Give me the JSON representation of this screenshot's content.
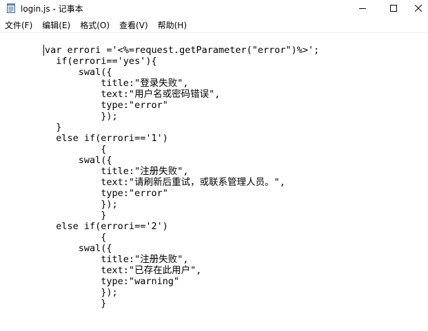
{
  "window": {
    "title": "login.js - 记事本",
    "icon": "notepad-icon",
    "controls": {
      "minimize_icon": "minimize-icon",
      "maximize_icon": "maximize-icon",
      "close_icon": "close-icon"
    }
  },
  "menu": [
    {
      "label": "文件(F)"
    },
    {
      "label": "编辑(E)"
    },
    {
      "label": "格式(O)"
    },
    {
      "label": "查看(V)"
    },
    {
      "label": "帮助(H)"
    }
  ],
  "editor": {
    "lines": [
      "        var errori ='<%=request.getParameter(\"error\")%>';",
      "          if(errori=='yes'){",
      "              swal({",
      "                  title:\"登录失败\",",
      "                  text:\"用户名或密码错误\",",
      "                  type:\"error\"",
      "                  });",
      "          }",
      "          else if(errori=='1')",
      "                  {",
      "              swal({",
      "                  title:\"注册失败\",",
      "                  text:\"请刷新后重试，或联系管理人员。\",",
      "                  type:\"error\"",
      "                  });",
      "                  }",
      "          else if(errori=='2')",
      "                  {",
      "              swal({",
      "                  title:\"注册失败\",",
      "                  text:\"已存在此用户\",",
      "                  type:\"warning\"",
      "                  });",
      "                  }"
    ]
  }
}
